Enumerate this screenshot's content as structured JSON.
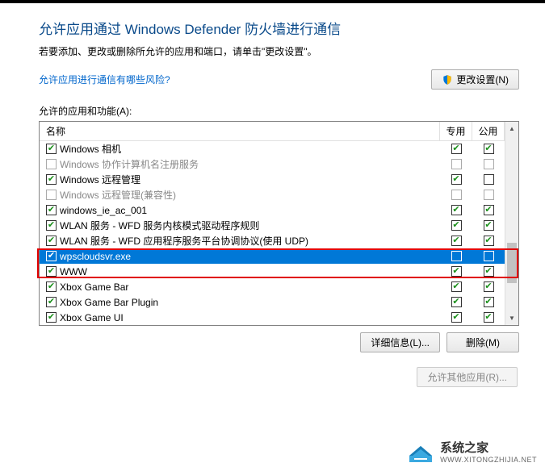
{
  "heading": "允许应用通过 Windows Defender 防火墙进行通信",
  "subtext": "若要添加、更改或删除所允许的应用和端口，请单击\"更改设置\"。",
  "risk_link": "允许应用进行通信有哪些风险?",
  "change_settings_btn": "更改设置(N)",
  "section_label": "允许的应用和功能(A):",
  "columns": {
    "name": "名称",
    "private": "专用",
    "public": "公用"
  },
  "rows": [
    {
      "checked": true,
      "name": "Windows 相机",
      "private": true,
      "public": true,
      "dim": false,
      "selected": false
    },
    {
      "checked": false,
      "name": "Windows 协作计算机名注册服务",
      "private": false,
      "public": false,
      "dim": true,
      "selected": false
    },
    {
      "checked": true,
      "name": "Windows 远程管理",
      "private": true,
      "public": false,
      "dim": false,
      "selected": false
    },
    {
      "checked": false,
      "name": "Windows 远程管理(兼容性)",
      "private": false,
      "public": false,
      "dim": true,
      "selected": false
    },
    {
      "checked": true,
      "name": "windows_ie_ac_001",
      "private": true,
      "public": true,
      "dim": false,
      "selected": false
    },
    {
      "checked": true,
      "name": "WLAN 服务 - WFD 服务内核模式驱动程序规则",
      "private": true,
      "public": true,
      "dim": false,
      "selected": false
    },
    {
      "checked": true,
      "name": "WLAN 服务 - WFD 应用程序服务平台协调协议(使用 UDP)",
      "private": true,
      "public": true,
      "dim": false,
      "selected": false
    },
    {
      "checked": true,
      "name": "wpscloudsvr.exe",
      "private": false,
      "public": false,
      "dim": false,
      "selected": true
    },
    {
      "checked": true,
      "name": "WWW",
      "private": true,
      "public": true,
      "dim": false,
      "selected": false
    },
    {
      "checked": true,
      "name": "Xbox Game Bar",
      "private": true,
      "public": true,
      "dim": false,
      "selected": false
    },
    {
      "checked": true,
      "name": "Xbox Game Bar Plugin",
      "private": true,
      "public": true,
      "dim": false,
      "selected": false
    },
    {
      "checked": true,
      "name": "Xbox Game UI",
      "private": true,
      "public": true,
      "dim": false,
      "selected": false
    }
  ],
  "details_btn": "详细信息(L)...",
  "remove_btn": "删除(M)",
  "allow_other_btn": "允许其他应用(R)...",
  "watermark": {
    "cn": "系统之家",
    "en": "WWW.XITONGZHIJIA.NET"
  }
}
